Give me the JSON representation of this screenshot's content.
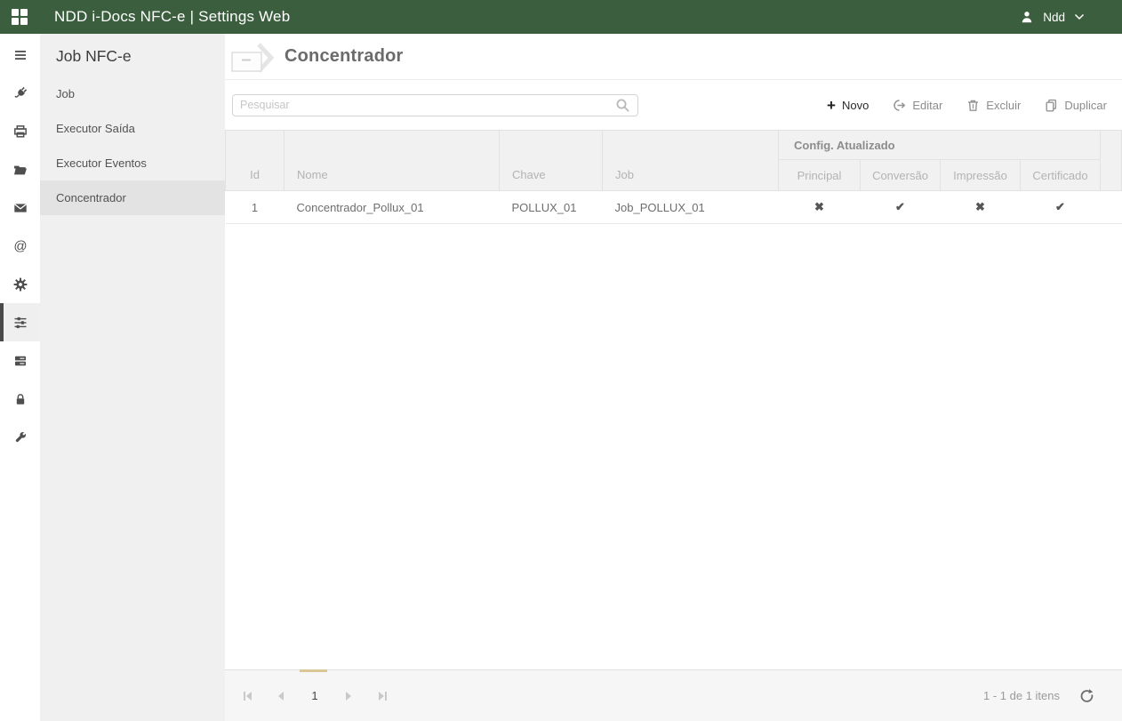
{
  "topbar": {
    "title": "NDD i-Docs NFC-e | Settings Web",
    "user_name": "Ndd"
  },
  "colors": {
    "topbar_bg": "#3b5f3e",
    "rail_icon": "#4f4f4f",
    "selected_page_indicator": "#dbc795"
  },
  "rail": {
    "icons": [
      "menu",
      "plug",
      "printer",
      "folder",
      "mail",
      "at-sign",
      "gear",
      "sliders",
      "queue",
      "lock",
      "wrench"
    ],
    "selected_icon": "sliders"
  },
  "sidebar": {
    "title": "Job NFC-e",
    "items": [
      {
        "label": "Job",
        "selected": false
      },
      {
        "label": "Executor Saída",
        "selected": false
      },
      {
        "label": "Executor Eventos",
        "selected": false
      },
      {
        "label": "Concentrador",
        "selected": true
      }
    ]
  },
  "page": {
    "title": "Concentrador"
  },
  "toolbar": {
    "search_placeholder": "Pesquisar",
    "novo": "Novo",
    "editar": "Editar",
    "excluir": "Excluir",
    "duplicar": "Duplicar"
  },
  "table": {
    "columns": {
      "id": "Id",
      "nome": "Nome",
      "chave": "Chave",
      "job": "Job"
    },
    "group_header": "Config. Atualizado",
    "sub_columns": {
      "principal": "Principal",
      "conversao": "Conversão",
      "impressao": "Impressão",
      "certificado": "Certificado"
    },
    "rows": [
      {
        "id": "1",
        "nome": "Concentrador_Pollux_01",
        "chave": "POLLUX_01",
        "job": "Job_POLLUX_01",
        "principal": "✖",
        "conversao": "✔",
        "impressao": "✖",
        "certificado": "✔"
      }
    ]
  },
  "pager": {
    "current_page": "1",
    "summary": "1 - 1 de 1 itens"
  }
}
